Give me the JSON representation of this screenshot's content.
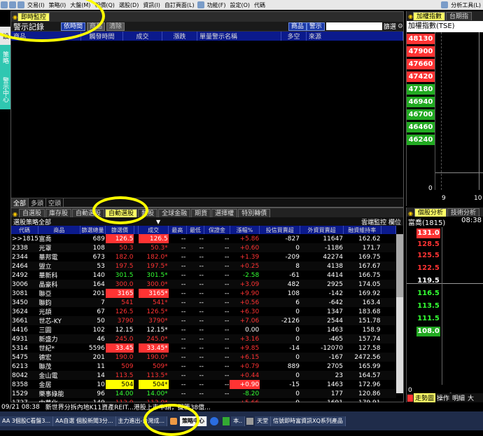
{
  "menubar": {
    "items": [
      "交易(I)",
      "策略(I)",
      "大盤(M)",
      "報價(Q)",
      "選股(D)",
      "資訊(I)",
      "自訂頁面(L)",
      "功能(F)",
      "設定(O)",
      "代碼"
    ],
    "right_label": "分析工具(L)"
  },
  "side_tabs": [
    "設",
    "策略",
    "警示中心"
  ],
  "alert_panel": {
    "tab": "即時監控",
    "title": "警示記錄",
    "buttons": [
      "依時間",
      "商品",
      "清除"
    ],
    "right_buttons": [
      "商品",
      "警示"
    ],
    "filter_label": "篩選",
    "columns": [
      "商品",
      "觸發時間",
      "成交",
      "漲跌",
      "單量警示名稱",
      "多空",
      "來源"
    ],
    "bottom_tabs": [
      "全部",
      "多頭",
      "空頭"
    ]
  },
  "index_panel": {
    "tabs": [
      "加權指數",
      "台期指"
    ],
    "title": "加權指數(TSE)",
    "levels": [
      "48130",
      "47900",
      "47660",
      "47420",
      "47180",
      "46940",
      "46700",
      "46460",
      "46240"
    ],
    "highlight_level": "46240",
    "bottom_labels": [
      "0",
      "9",
      "10"
    ],
    "volume_label": "0"
  },
  "screener": {
    "tabs": [
      "自選股",
      "庫存股",
      "自動選股",
      "自動選股",
      "類股",
      "全球金融",
      "期貨",
      "選擇權",
      "特別轉債"
    ],
    "active_tab_index": 3,
    "strategy_label": "選股策略全部",
    "right_labels": [
      "雲端監控",
      "欄位"
    ],
    "columns": [
      "代碼",
      "商品",
      "篩選總量",
      "篩選價",
      "漲跌",
      "成交",
      "最高",
      "最低",
      "保證金",
      "漲幅%",
      "投信買賣超",
      "外資買賣超",
      "融資維持率"
    ],
    "rows": [
      {
        "code": ">>1815",
        "name": "富喬",
        "vol": "689",
        "price": "126.5",
        "pcls": "up bgup",
        "chg": "126.5",
        "chgcls": "up bgup",
        "close": "--",
        "high": "--",
        "low": "--",
        "margin": "+5.86",
        "mcls": "up",
        "trust": "-827",
        "foreign": "11647",
        "ratio": "162.62"
      },
      {
        "code": "2338",
        "name": "光罩",
        "vol": "108",
        "price": "50.3",
        "pcls": "up",
        "chg": "50.3*",
        "chgcls": "up",
        "close": "--",
        "high": "--",
        "low": "--",
        "margin": "+0.60",
        "mcls": "up",
        "trust": "0",
        "foreign": "-1186",
        "ratio": "171.7"
      },
      {
        "code": "2344",
        "name": "華邦電",
        "vol": "673",
        "price": "182.0",
        "pcls": "up",
        "chg": "182.0*",
        "chgcls": "up",
        "close": "--",
        "high": "--",
        "low": "--",
        "margin": "+1.39",
        "mcls": "up",
        "trust": "-209",
        "foreign": "42274",
        "ratio": "169.75"
      },
      {
        "code": "2464",
        "name": "盟立",
        "vol": "53",
        "price": "197.5",
        "pcls": "up",
        "chg": "197.5*",
        "chgcls": "up",
        "close": "--",
        "high": "--",
        "low": "--",
        "margin": "+0.25",
        "mcls": "up",
        "trust": "8",
        "foreign": "4138",
        "ratio": "167.67"
      },
      {
        "code": "2492",
        "name": "華新科",
        "vol": "140",
        "price": "301.5",
        "pcls": "dn",
        "chg": "301.5*",
        "chgcls": "dn",
        "close": "--",
        "high": "--",
        "low": "--",
        "margin": "-2.58",
        "mcls": "dn",
        "trust": "-61",
        "foreign": "4414",
        "ratio": "166.75"
      },
      {
        "code": "3006",
        "name": "晶豪科",
        "vol": "164",
        "price": "300.0",
        "pcls": "up",
        "chg": "300.0*",
        "chgcls": "up",
        "close": "--",
        "high": "--",
        "low": "--",
        "margin": "+3.09",
        "mcls": "up",
        "trust": "482",
        "foreign": "2925",
        "ratio": "174.05"
      },
      {
        "code": "3081",
        "name": "聯亞",
        "vol": "201",
        "price": "3165",
        "pcls": "up bgup",
        "chg": "3165*",
        "chgcls": "up bgup",
        "close": "--",
        "high": "--",
        "low": "--",
        "margin": "+9.90",
        "mcls": "up",
        "trust": "108",
        "foreign": "-142",
        "ratio": "169.92"
      },
      {
        "code": "3450",
        "name": "聯鈞",
        "vol": "7",
        "price": "541",
        "pcls": "up",
        "chg": "541*",
        "chgcls": "up",
        "close": "--",
        "high": "--",
        "low": "--",
        "margin": "+0.56",
        "mcls": "up",
        "trust": "6",
        "foreign": "-642",
        "ratio": "163.4"
      },
      {
        "code": "3624",
        "name": "光頡",
        "vol": "67",
        "price": "126.5",
        "pcls": "up",
        "chg": "126.5*",
        "chgcls": "up",
        "close": "--",
        "high": "--",
        "low": "--",
        "margin": "+6.30",
        "mcls": "up",
        "trust": "0",
        "foreign": "1347",
        "ratio": "183.68"
      },
      {
        "code": "3661",
        "name": "世芯-KY",
        "vol": "50",
        "price": "3790",
        "pcls": "up",
        "chg": "3790*",
        "chgcls": "up",
        "close": "--",
        "high": "--",
        "low": "--",
        "margin": "+7.06",
        "mcls": "up",
        "trust": "-2126",
        "foreign": "2544",
        "ratio": "151.78"
      },
      {
        "code": "4416",
        "name": "三圓",
        "vol": "102",
        "price": "12.15",
        "pcls": "fl",
        "chg": "12.15*",
        "chgcls": "fl",
        "close": "--",
        "high": "--",
        "low": "--",
        "margin": "0.00",
        "mcls": "fl",
        "trust": "0",
        "foreign": "1463",
        "ratio": "158.9"
      },
      {
        "code": "4931",
        "name": "新盛力",
        "vol": "46",
        "price": "245.0",
        "pcls": "up",
        "chg": "245.0*",
        "chgcls": "up",
        "close": "--",
        "high": "--",
        "low": "--",
        "margin": "+3.16",
        "mcls": "up",
        "trust": "0",
        "foreign": "-465",
        "ratio": "157.74"
      },
      {
        "code": "5314",
        "name": "世紀*",
        "vol": "5596",
        "price": "33.45",
        "pcls": "up bgup",
        "chg": "33.45*",
        "chgcls": "up bgup",
        "close": "--",
        "high": "--",
        "low": "--",
        "margin": "+9.85",
        "mcls": "up",
        "trust": "-14",
        "foreign": "-12070",
        "ratio": "127.58"
      },
      {
        "code": "5475",
        "name": "德宏",
        "vol": "201",
        "price": "190.0",
        "pcls": "up",
        "chg": "190.0*",
        "chgcls": "up",
        "close": "--",
        "high": "--",
        "low": "--",
        "margin": "+6.15",
        "mcls": "up",
        "trust": "0",
        "foreign": "-167",
        "ratio": "2472.56"
      },
      {
        "code": "6213",
        "name": "聯茂",
        "vol": "11",
        "price": "509",
        "pcls": "up",
        "chg": "509*",
        "chgcls": "up",
        "close": "--",
        "high": "--",
        "low": "--",
        "margin": "+0.79",
        "mcls": "up",
        "trust": "889",
        "foreign": "2705",
        "ratio": "165.99"
      },
      {
        "code": "8042",
        "name": "金山電",
        "vol": "14",
        "price": "113.5",
        "pcls": "up",
        "chg": "113.5*",
        "chgcls": "up",
        "close": "--",
        "high": "--",
        "low": "--",
        "margin": "+0.44",
        "mcls": "up",
        "trust": "0",
        "foreign": "23",
        "ratio": "164.57"
      },
      {
        "code": "8358",
        "name": "金居",
        "vol": "10",
        "price": "504",
        "pcls": "up bgfl",
        "chg": "504*",
        "chgcls": "up bgfl",
        "close": "--",
        "high": "--",
        "low": "--",
        "margin": "+0.90",
        "mcls": "up bgup",
        "trust": "-15",
        "foreign": "1463",
        "ratio": "172.96"
      },
      {
        "code": "1529",
        "name": "樂事綠能",
        "vol": "96",
        "price": "14.00",
        "pcls": "dn",
        "chg": "14.00*",
        "chgcls": "dn",
        "close": "--",
        "high": "--",
        "low": "--",
        "margin": "-8.20",
        "mcls": "dn",
        "trust": "0",
        "foreign": "177",
        "ratio": "120.86"
      },
      {
        "code": "1727",
        "name": "中華化",
        "vol": "149",
        "price": "112.0",
        "pcls": "up",
        "chg": "112.0*",
        "chgcls": "up",
        "close": "--",
        "high": "--",
        "low": "--",
        "margin": "+5.66",
        "mcls": "up",
        "trust": "0",
        "foreign": "1691",
        "ratio": "179.91"
      },
      {
        "code": "2221",
        "name": "大甲",
        "vol": "426",
        "price": "140.0",
        "pcls": "up bgup",
        "chg": "140.0*",
        "chgcls": "up bgup",
        "close": "--",
        "high": "--",
        "low": "--",
        "margin": "+9.80",
        "mcls": "up",
        "trust": "0",
        "foreign": "246",
        "ratio": "198.42"
      }
    ]
  },
  "detail_panel": {
    "tabs": [
      "個股分析",
      "技術分析"
    ],
    "title": "富喬(1815)",
    "time": "08:38",
    "prices": [
      "131.0",
      "128.5",
      "125.5",
      "122.5",
      "119.5",
      "116.5",
      "113.5",
      "111.5",
      "108.0"
    ],
    "bottom_labels": [
      "0",
      "9"
    ],
    "bottom_tabs": [
      "走勢圖",
      "操作",
      "明細",
      "大"
    ]
  },
  "ticker": {
    "time": "09/21 08:38",
    "text": "新世界分拆內地K11資產REIT...港股上市申請，擬籌38億..."
  },
  "taskbar": {
    "items": [
      "AA 3個股C看盤3...",
      "AA自選 個股新聞3分...",
      "主力進出-台灣成...",
      "策略中心",
      "本..",
      "天堂",
      "信號即時富資訊XQ系列產品"
    ]
  },
  "colors": {
    "up": "#ff3333",
    "down": "#33ff33",
    "flat": "#ffffff",
    "header_blue": "#0b1a8c",
    "highlight_yellow": "#ffff66"
  }
}
